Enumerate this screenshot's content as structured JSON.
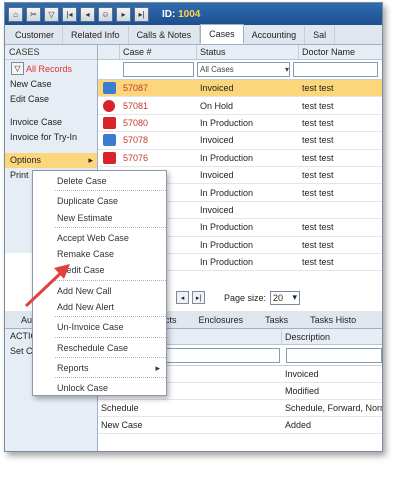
{
  "titlebar": {
    "id_label": "ID:",
    "id_value": "1004"
  },
  "main_tabs": [
    "Customer",
    "Related Info",
    "Calls & Notes",
    "Cases",
    "Accounting",
    "Sal"
  ],
  "sidebar": {
    "header": "CASES",
    "filter_label": "All Records",
    "items": [
      "New Case",
      "Edit Case",
      "Invoice Case",
      "Invoice for Try-In",
      "Options",
      "Print"
    ],
    "options_arrow": "▸"
  },
  "grid": {
    "columns": [
      "Case #",
      "Status",
      "Doctor Name"
    ],
    "status_filter": "All Cases",
    "rows": [
      {
        "icon": "blue",
        "case": "57087",
        "status": "Invoiced",
        "doctor": "test test"
      },
      {
        "icon": "pause",
        "case": "57081",
        "status": "On Hold",
        "doctor": "test test"
      },
      {
        "icon": "red",
        "case": "57080",
        "status": "In Production",
        "doctor": "test test"
      },
      {
        "icon": "blue",
        "case": "57078",
        "status": "Invoiced",
        "doctor": "test test"
      },
      {
        "icon": "red",
        "case": "57076",
        "status": "In Production",
        "doctor": "test test"
      },
      {
        "icon": "",
        "case": "",
        "status": "Invoiced",
        "doctor": "test test"
      },
      {
        "icon": "",
        "case": "",
        "status": "In Production",
        "doctor": "test test"
      },
      {
        "icon": "",
        "case": "",
        "status": "Invoiced",
        "doctor": ""
      },
      {
        "icon": "",
        "case": "",
        "status": "In Production",
        "doctor": "test test"
      },
      {
        "icon": "",
        "case": "",
        "status": "In Production",
        "doctor": "test test"
      },
      {
        "icon": "",
        "case": "",
        "status": "In Production",
        "doctor": "test test"
      }
    ]
  },
  "pager": {
    "page_size_label": "Page size:",
    "page_size": "20"
  },
  "lower_tabs": [
    "Au",
    "oducts",
    "Enclosures",
    "Tasks",
    "Tasks Histo"
  ],
  "lower_side": {
    "header": "ACTIC",
    "item": "Set C"
  },
  "lower_grid": {
    "columns": [
      "",
      "Description"
    ],
    "rows": [
      {
        "a": "",
        "b": "Invoiced"
      },
      {
        "a": "Revision",
        "b": "Modified"
      },
      {
        "a": "Schedule",
        "b": "Schedule, Forward, Normal"
      },
      {
        "a": "New Case",
        "b": "Added"
      }
    ]
  },
  "context_menu": {
    "items": [
      "Delete Case",
      "Duplicate Case",
      "New Estimate",
      "Accept Web Case",
      "Remake Case",
      "Credit Case",
      "Add New Call",
      "Add New Alert",
      "Un-Invoice Case",
      "Reschedule Case",
      "Reports",
      "Unlock Case"
    ],
    "reports_arrow": "▸"
  },
  "colors": {
    "selected_row": "#fbd67a",
    "titlebar": "#2f6db0",
    "annotation_arrow": "#e04040"
  }
}
